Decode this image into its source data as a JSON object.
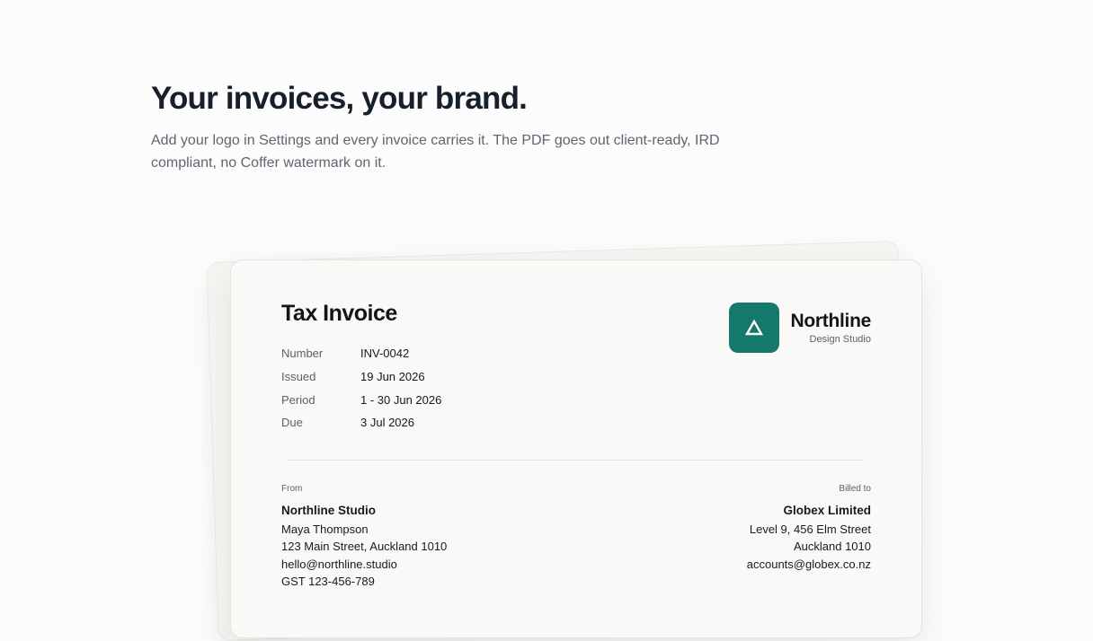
{
  "hero": {
    "title": "Your invoices, your brand.",
    "subtitle": "Add your logo in Settings and every invoice carries it. The PDF goes out client-ready, IRD compliant, no Coffer watermark on it."
  },
  "invoice": {
    "title": "Tax Invoice",
    "meta": [
      {
        "label": "Number",
        "value": "INV-0042"
      },
      {
        "label": "Issued",
        "value": "19 Jun 2026"
      },
      {
        "label": "Period",
        "value": "1 - 30 Jun 2026"
      },
      {
        "label": "Due",
        "value": "3 Jul 2026"
      }
    ],
    "brand": {
      "name": "Northline",
      "sub": "Design Studio",
      "icon": "triangle-logo-icon",
      "color": "#14786b"
    },
    "from": {
      "label": "From",
      "name": "Northline Studio",
      "lines": [
        "Maya Thompson",
        "123 Main Street, Auckland 1010",
        "hello@northline.studio",
        "GST 123-456-789"
      ]
    },
    "to": {
      "label": "Billed to",
      "name": "Globex Limited",
      "lines": [
        "Level 9, 456 Elm Street",
        "Auckland 1010",
        "accounts@globex.co.nz"
      ]
    }
  }
}
